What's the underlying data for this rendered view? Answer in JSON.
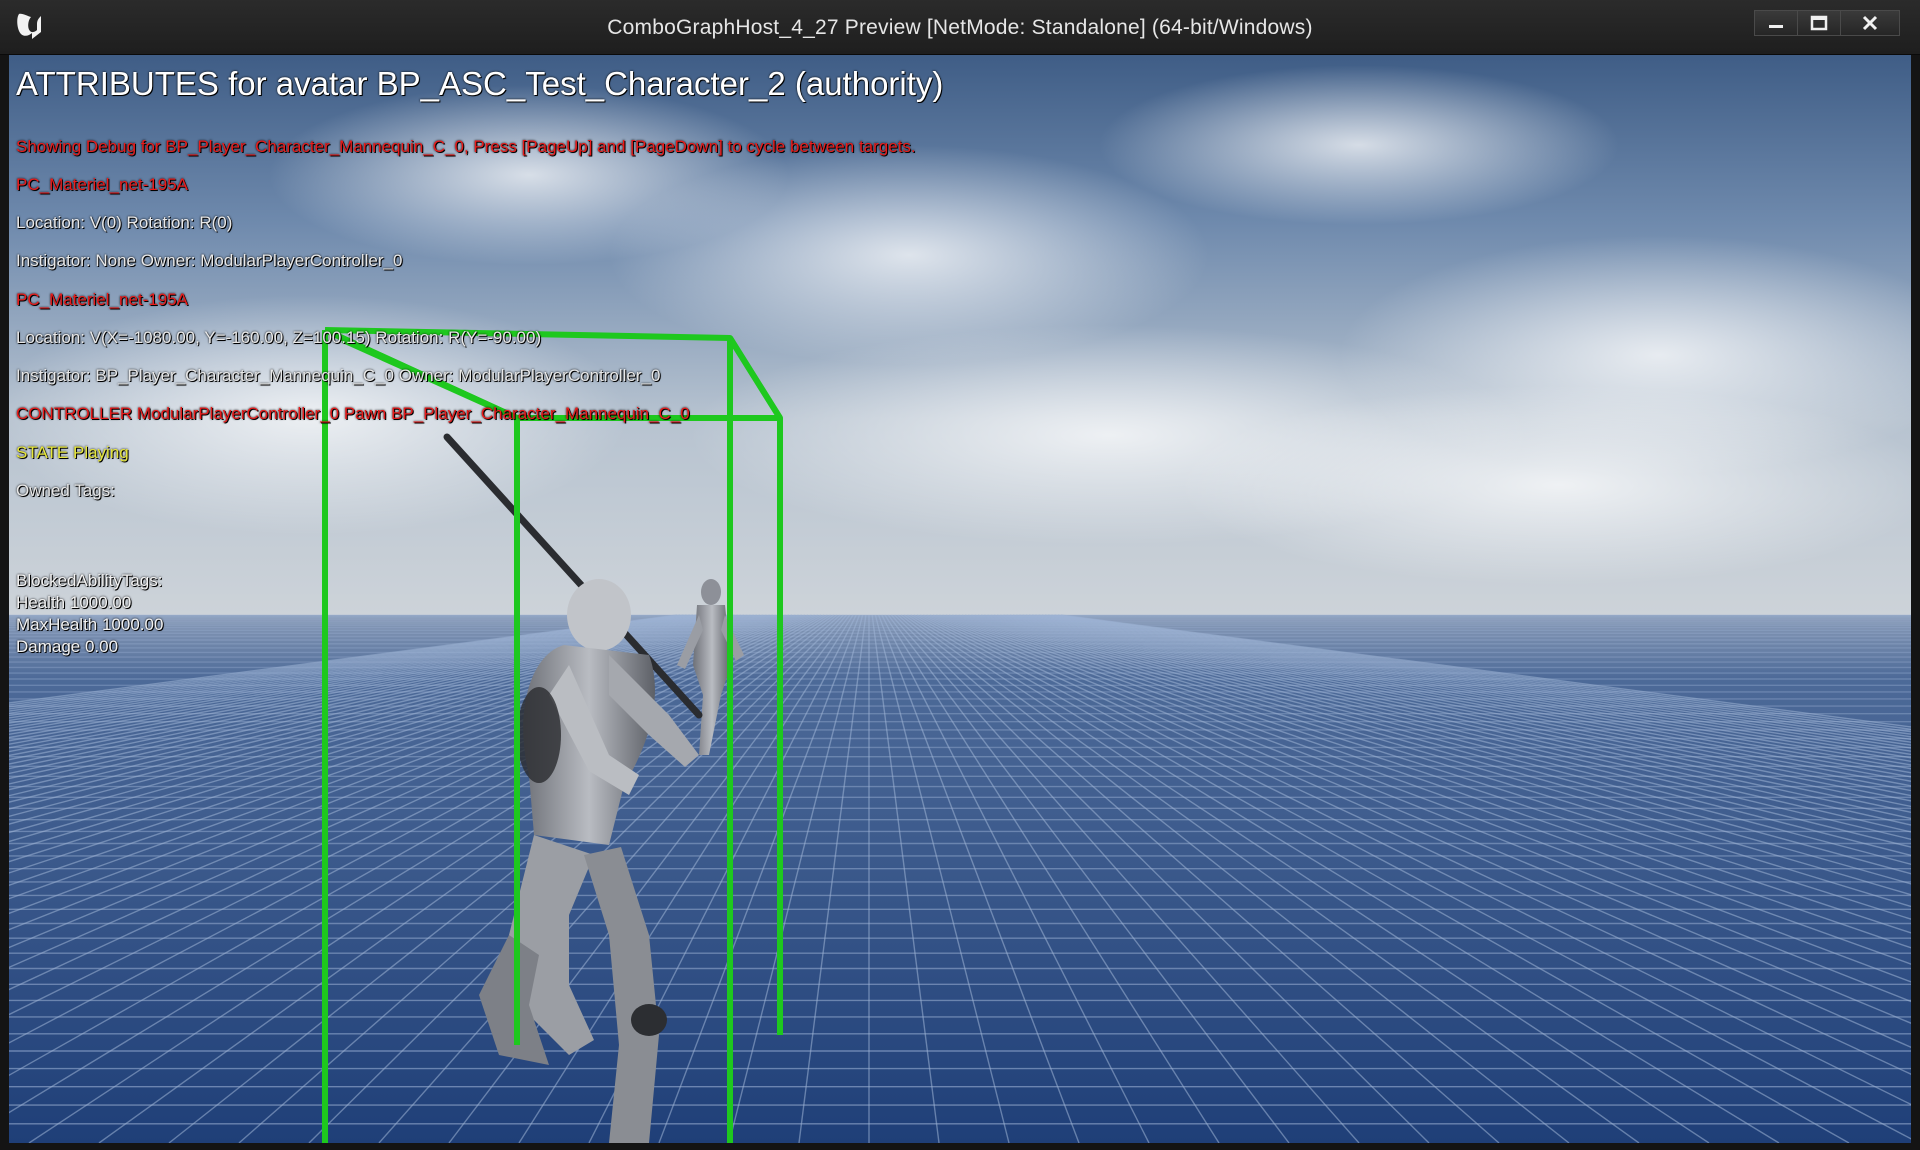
{
  "window": {
    "title": "ComboGraphHost_4_27 Preview [NetMode: Standalone]  (64-bit/Windows)",
    "logo_icon": "unreal-engine-logo-icon",
    "controls": [
      "minimize",
      "maximize",
      "close"
    ]
  },
  "hud": {
    "header": "ATTRIBUTES for avatar BP_ASC_Test_Character_2 (authority)",
    "debug_hint": "Showing Debug for BP_Player_Character_Mannequin_C_0, Press [PageUp] and [PageDown] to cycle between targets.",
    "pc_name_1": "PC_Materiel_net-195A",
    "location_1": "Location: V(0) Rotation: R(0)",
    "instigator_1": " Instigator: None Owner: ModularPlayerController_0",
    "pc_name_2": "PC_Materiel_net-195A",
    "location_2": "Location: V(X=-1080.00, Y=-160.00, Z=100.15) Rotation: R(Y=-90.00)",
    "instigator_2": " Instigator: BP_Player_Character_Mannequin_C_0 Owner: ModularPlayerController_0",
    "controller": "CONTROLLER ModularPlayerController_0 Pawn BP_Player_Character_Mannequin_C_0",
    "state": "STATE Playing",
    "owned_tags": "Owned Tags:",
    "blocked_tags": "BlockedAbilityTags:",
    "attributes": {
      "health": "Health 1000.00",
      "max_health": "MaxHealth 1000.00",
      "damage": "Damage 0.00"
    }
  },
  "colors": {
    "debug_red": "#e81c1c",
    "state_yellow": "#e6e63c",
    "collision_green": "#1ec81e",
    "floor_tile": "#2f4f86"
  }
}
